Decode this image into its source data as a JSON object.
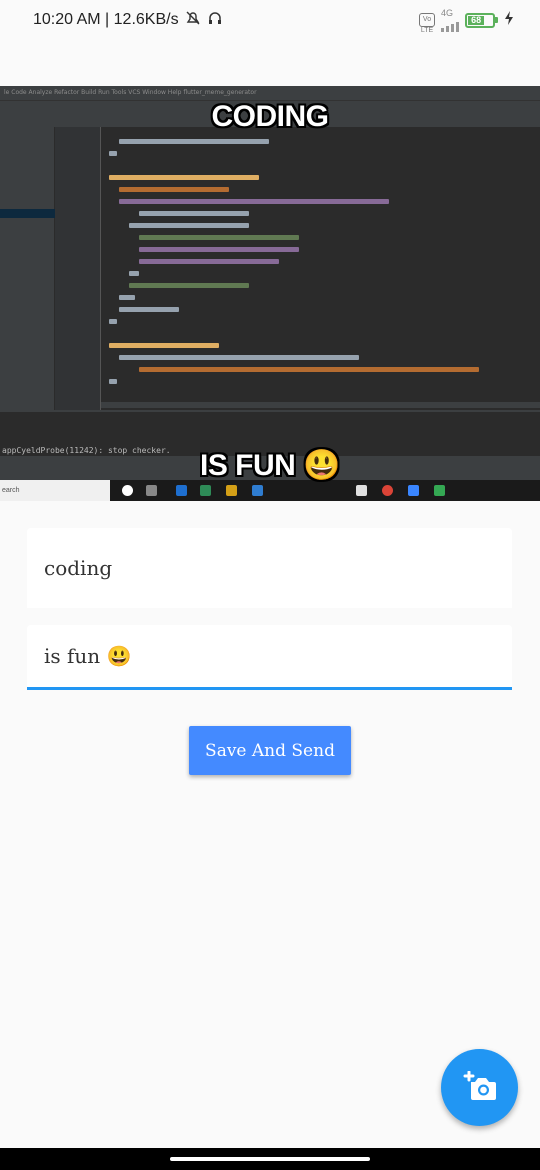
{
  "status_bar": {
    "time_speed": "10:20 AM | 12.6KB/s",
    "icons": [
      "alarm-icon",
      "headphones-icon",
      "volte-icon",
      "signal-icon",
      "battery-icon",
      "charging-icon"
    ],
    "volte_label": "Vo LTE",
    "network_label": "4G",
    "battery_level": "68"
  },
  "meme": {
    "top_caption": "CODING",
    "bottom_caption": "IS FUN 😃",
    "ide_menu": "le  Code  Analyze  Refactor  Build  Run  Tools  VCS  Window  Help   flutter_meme_generator",
    "ide_log": "appCyeldProbe(11242): stop checker.",
    "taskbar_search": "earch"
  },
  "form": {
    "top_text_value": "coding",
    "bottom_text_value": "is fun 😃",
    "save_button_label": "Save And Send"
  },
  "fab": {
    "icon": "add-photo-icon"
  },
  "colors": {
    "accent": "#2196f3",
    "button": "#448aff",
    "background": "#fafafa"
  }
}
